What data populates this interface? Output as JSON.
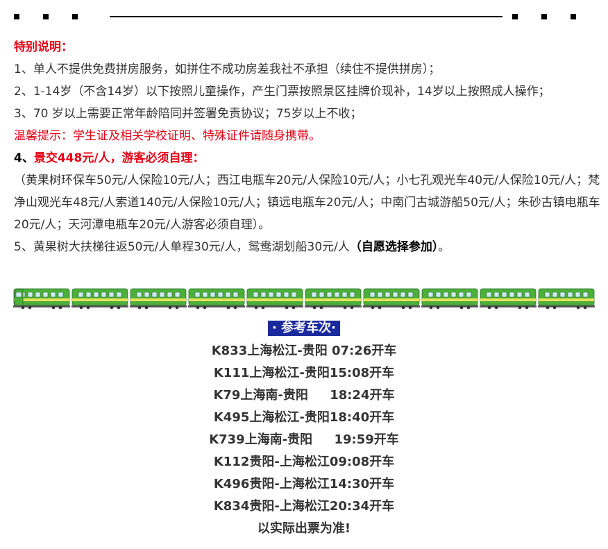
{
  "notes": {
    "heading": "特别说明：",
    "item1": "1、单人不提供免费拼房服务，如拼住不成功房差我社不承担（续住不提供拼房）；",
    "item2": "2、1-14岁（不含14岁）以下按照儿童操作，产生门票按照景区挂牌价现补，14岁以上按照成人操作；",
    "item3": "3、70 岁以上需要正常年龄陪同并签署免责协议；75岁以上不收；",
    "tip": "温馨提示：学生证及相关学校证明、特殊证件请随身携带。",
    "item4_prefix": "4、",
    "item4_title": "景交448元/人，游客必须自理：",
    "item4_detail": "（黄果树环保车50元/人保险10元/人；西江电瓶车20元/人保险10元/人；小七孔观光车40元/人保险10元/人；梵净山观光车48元/人索道140元/人保险10元/人；镇远电瓶车20元/人；中南门古城游船50元/人；朱砂古镇电瓶车20元/人；天河潭电瓶车20元/人游客必须自理）。",
    "item5_text": "5、黄果树大扶梯往返50元/人单程30元/人，鸳鸯湖划船30元/人",
    "item5_note": "（自愿选择参加）",
    "item5_end": "。"
  },
  "schedule": {
    "title": "· 参考车次·",
    "rows": [
      "K833上海松江-贵阳 07:26开车",
      "K111上海松江-贵阳15:08开车",
      "K79上海南-贵阳     18:24开车",
      "K495上海松江-贵阳18:40开车",
      "K739上海南-贵阳     19:59开车",
      "K112贵阳-上海松江09:08开车",
      "K496贵阳-上海松江14:30开车",
      "K834贵阳-上海松江20:34开车"
    ],
    "footer": "以实际出票为准!"
  },
  "colors": {
    "red": "#e60012",
    "title_bg": "#1a2a9e",
    "train_green": "#4caf3a",
    "train_yellow": "#e8e25a"
  }
}
